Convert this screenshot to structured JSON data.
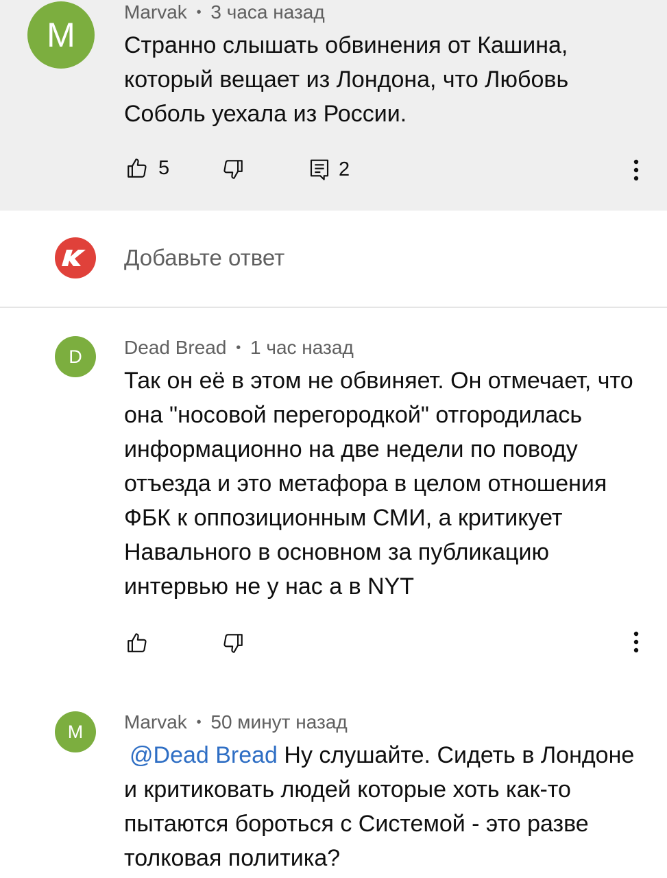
{
  "comments": [
    {
      "avatar_letter": "M",
      "avatar_color": "#7cae3f",
      "author": "Marvak",
      "separator": "•",
      "time": "3 часа назад",
      "text": "Странно слышать обвинения от Кашина, который вещает из Лондона, что Любовь Соболь уехала из России.",
      "likes": "5",
      "replies": "2"
    },
    {
      "avatar_letter": "D",
      "avatar_color": "#7cae3f",
      "author": "Dead Bread",
      "separator": "•",
      "time": "1 час назад",
      "text": "Так он её в этом не обвиняет. Он отмечает, что она \"носовой перегородкой\" отгородилась информационно на две недели по поводу отъезда и это метафора в целом отношения ФБК к оппозиционным СМИ, а критикует Навального в основном за публикацию интервью не у нас а в NYT"
    },
    {
      "avatar_letter": "M",
      "avatar_color": "#7cae3f",
      "author": "Marvak",
      "separator": "•",
      "time": "50 минут назад",
      "mention": "@Dead Bread",
      "text": " Ну слушайте. Сидеть в Лондоне и критиковать людей которые хоть как-то пытаются бороться с Системой - это разве толковая политика?"
    }
  ],
  "reply_input": {
    "placeholder": "Добавьте ответ",
    "avatar_letter": "K",
    "avatar_color": "#e0413a"
  },
  "colors": {
    "mention": "#2e6ec4",
    "meta": "#606060",
    "highlight_bg": "#efefef"
  },
  "icons": [
    "thumb-up-icon",
    "thumb-down-icon",
    "comment-icon",
    "more-vert-icon"
  ]
}
